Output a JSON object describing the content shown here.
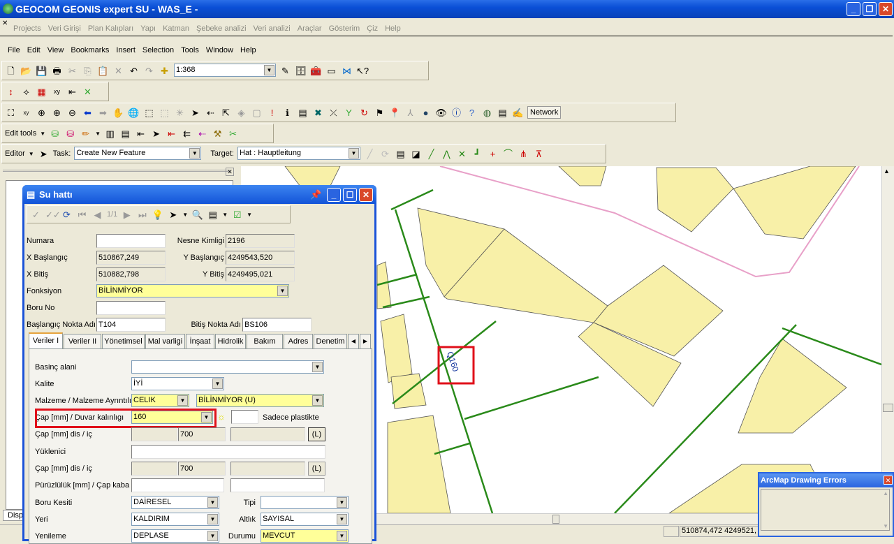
{
  "app": {
    "title": "GEOCOM GEONIS expert SU - WAS_E -"
  },
  "geonis_menu": [
    "Projects",
    "Veri Girişi",
    "Plan Kalıpları",
    "Yapı",
    "Katman",
    "Şebeke analizi",
    "Veri analizi",
    "Araçlar",
    "Gösterim",
    "Çiz",
    "Help"
  ],
  "menu": [
    "File",
    "Edit",
    "View",
    "Bookmarks",
    "Insert",
    "Selection",
    "Tools",
    "Window",
    "Help"
  ],
  "toolbar": {
    "scale": "1:368",
    "network_label": "Network",
    "edit_tools_label": "Edit tools",
    "editor_label": "Editor",
    "task_label": "Task:",
    "task_value": "Create New Feature",
    "target_label": "Target:",
    "target_value": "Hat : Hauptleitung"
  },
  "map": {
    "annotation": "Q160",
    "highlight_color": "#e0101a",
    "pipe_color": "#2a8a1a",
    "building_color": "#f8f0a8",
    "boundary_color": "#e8a0c8"
  },
  "left_panel": {
    "tab": "Disp"
  },
  "status": {
    "coords": "510874,472  4249521,"
  },
  "errors_dialog": {
    "title": "ArcMap Drawing Errors"
  },
  "dialog": {
    "title": "Su hattı",
    "record": "1/1",
    "fields": {
      "numara_label": "Numara",
      "numara": "",
      "nesne_label": "Nesne Kimligi",
      "nesne": "2196",
      "xbas_label": "X Başlangıç",
      "xbas": "510867,249",
      "ybas_label": "Y Başlangıç",
      "ybas": "4249543,520",
      "xbit_label": "X Bitiş",
      "xbit": "510882,798",
      "ybit_label": "Y Bitiş",
      "ybit": "4249495,021",
      "fonk_label": "Fonksiyon",
      "fonk": "BİLİNMİYOR",
      "boru_label": "Boru No",
      "boru": "",
      "basnokta_label": "Başlangıç Nokta Adı",
      "basnokta": "T104",
      "bitnokta_label": "Bitiş Nokta Adı",
      "bitnokta": "BS106"
    },
    "tabs": [
      "Veriler I",
      "Veriler II",
      "Yönetimsel",
      "Mal varligi",
      "İnşaat",
      "Hidrolik",
      "Bakım",
      "Adres",
      "Denetim"
    ],
    "veriler1": {
      "basinc_label": "Basinç alani",
      "basinc": "",
      "kalite_label": "Kalite",
      "kalite": "İYİ",
      "malzeme_label": "Malzeme / Malzeme Ayrıntılı",
      "malzeme": "CELIK",
      "malzeme_detay": "BİLİNMİYOR (U)",
      "cap_label": "Çap [mm] / Duvar kalınlıgı",
      "cap": "160",
      "cap_extra": "",
      "plastik_label": "Sadece plastikte",
      "capdis1_label": "Çap [mm] dis / iç",
      "capdis1_a": "",
      "capdis1_b": "700",
      "capdis1_c": "",
      "l_button": "(L)",
      "yuklenici_label": "Yüklenici",
      "yuklenici": "",
      "capdis2_label": "Çap [mm] dis / iç",
      "capdis2_a": "",
      "capdis2_b": "700",
      "capdis2_c": "",
      "puruz_label": "Pürüzlülük [mm] / Çap kaba",
      "puruz": "",
      "capkaba": "",
      "kesit_label": "Boru Kesiti",
      "kesit": "DAİRESEL",
      "tipi_label": "Tipi",
      "tipi": "",
      "yeri_label": "Yeri",
      "yeri": "KALDIRIM",
      "altlik_label": "Altlık",
      "altlik": "SAYISAL",
      "yenileme_label": "Yenileme",
      "yenileme": "DEPLASE",
      "durumu_label": "Durumu",
      "durumu": "MEVCUT"
    }
  }
}
